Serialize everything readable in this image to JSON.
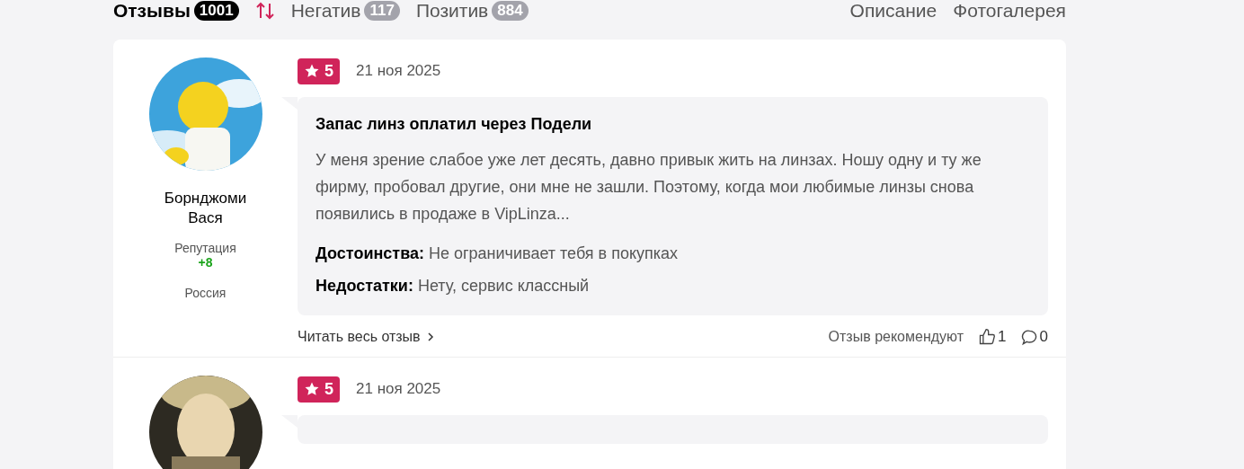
{
  "tabs": [
    {
      "label": "Отзывы",
      "count": "1001",
      "selected": true
    },
    {
      "label": "Негатив",
      "count": "117",
      "selected": false
    },
    {
      "label": "Позитив",
      "count": "884",
      "selected": false
    }
  ],
  "links": [
    "Описание",
    "Фотогалерея"
  ],
  "reviews": [
    {
      "author": "Борнджоми Вася",
      "reputation_label": "Репутация",
      "reputation": "+8",
      "country": "Россия",
      "rating": "5",
      "date": "21 ноя 2025",
      "title": "Запас линз оплатил через Подели",
      "text": "У меня зрение слабое уже лет десять, давно привык жить на линзах. Ношу одну и ту же фирму, пробовал другие, они мне не зашли. Поэтому, когда мои любимые линзы снова появились в продаже в VipLinza...",
      "pros_label": "Достоинства:",
      "pros": "Не ограничивает тебя в покупках",
      "cons_label": "Недостатки:",
      "cons": "Нету, сервис классный",
      "read_more": "Читать весь отзыв",
      "recommend": "Отзыв рекомендуют",
      "likes": "1",
      "comments": "0"
    },
    {
      "rating": "5",
      "date": "21 ноя 2025"
    }
  ]
}
